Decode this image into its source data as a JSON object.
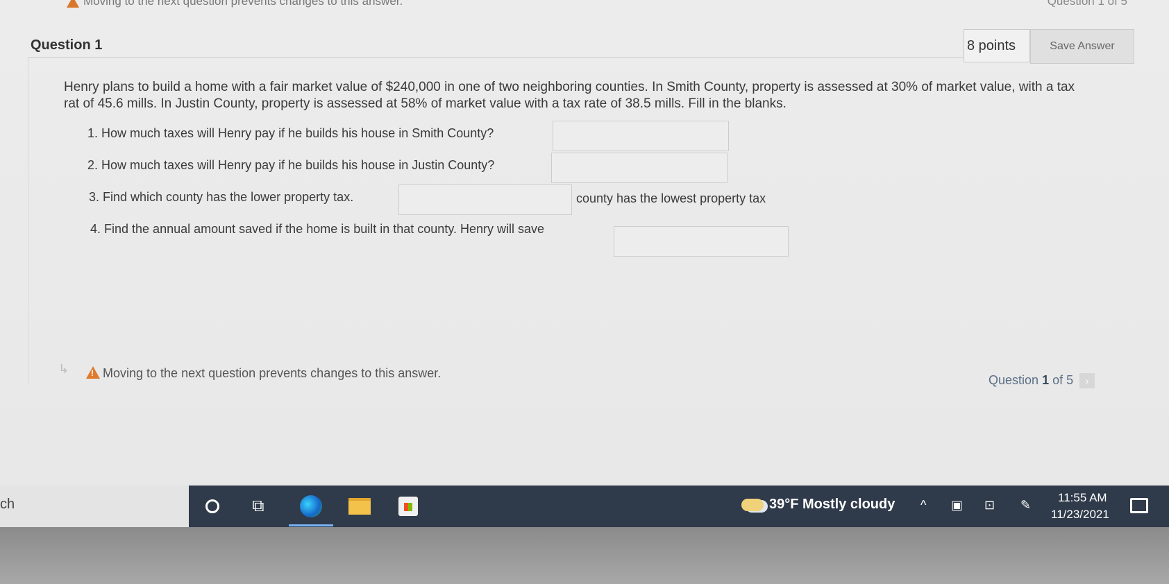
{
  "top_strip": {
    "warning": "Moving to the next question prevents changes to this answer.",
    "progress": "Question 1 of 5"
  },
  "question": {
    "title": "Question 1",
    "points": "8 points",
    "save_label": "Save Answer",
    "text": "Henry plans to build a home with a fair market value of $240,000 in one of two neighboring counties. In Smith County, property is assessed at 30% of market value, with a tax rat of 45.6 mills. In Justin County, property is assessed at 58% of market value with a tax rate of 38.5 mills.  Fill in the blanks.",
    "items": [
      {
        "label": "1. How much taxes will Henry pay if he builds his house in Smith County?",
        "value": ""
      },
      {
        "label": "2. How much taxes will Henry pay if he builds his house in Justin County?",
        "value": ""
      },
      {
        "label": "3. Find which county has the lower property tax.",
        "value": "",
        "suffix": "county has the lowest property tax"
      },
      {
        "label": "4. Find the annual amount saved if the home is built in that county. Henry will save",
        "value": ""
      }
    ]
  },
  "footer": {
    "warning": "Moving to the next question prevents changes to this answer.",
    "progress_prefix": "Question",
    "progress_current": "1",
    "progress_suffix": "of 5",
    "next_icon": "chevron-right"
  },
  "taskbar": {
    "search_text": "ch",
    "weather": "39°F  Mostly cloudy",
    "time": "11:55 AM",
    "date": "11/23/2021"
  }
}
